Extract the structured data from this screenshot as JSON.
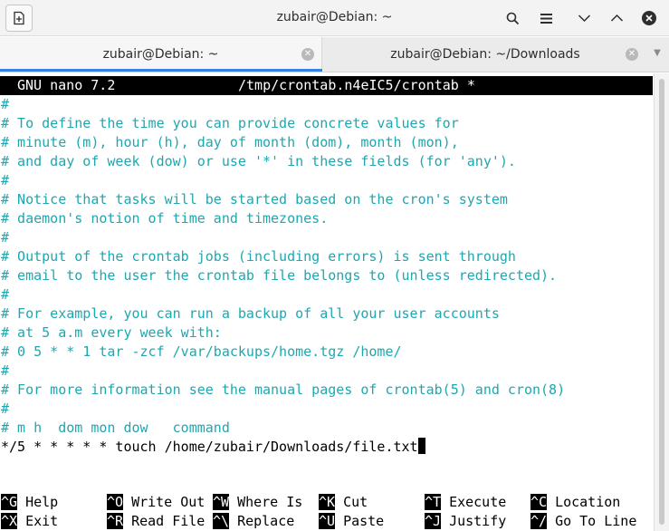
{
  "window": {
    "title": "zubair@Debian: ~",
    "new_tab_icon": "new-tab-icon",
    "search_icon": "search-icon",
    "menu_icon": "hamburger-menu-icon",
    "minimize_icon": "chevron-down-icon",
    "maximize_icon": "chevron-up-icon",
    "close_icon": "close-icon"
  },
  "tabs": [
    {
      "label": "zubair@Debian: ~",
      "active": true
    },
    {
      "label": "zubair@Debian: ~/Downloads",
      "active": false
    }
  ],
  "nano": {
    "program": "GNU nano 7.2",
    "filename": "/tmp/crontab.n4eIC5/crontab *",
    "lines": [
      "#",
      "# To define the time you can provide concrete values for",
      "# minute (m), hour (h), day of month (dom), month (mon),",
      "# and day of week (dow) or use '*' in these fields (for 'any').",
      "#",
      "# Notice that tasks will be started based on the cron's system",
      "# daemon's notion of time and timezones.",
      "#",
      "# Output of the crontab jobs (including errors) is sent through",
      "# email to the user the crontab file belongs to (unless redirected).",
      "#",
      "# For example, you can run a backup of all your user accounts",
      "# at 5 a.m every week with:",
      "# 0 5 * * 1 tar -zcf /var/backups/home.tgz /home/",
      "#",
      "# For more information see the manual pages of crontab(5) and cron(8)",
      "#",
      "# m h  dom mon dow   command",
      "*/5 * * * * * touch /home/zubair/Downloads/file.txt"
    ],
    "shortcuts_row1": [
      {
        "key": "^G",
        "label": "Help"
      },
      {
        "key": "^O",
        "label": "Write Out"
      },
      {
        "key": "^W",
        "label": "Where Is"
      },
      {
        "key": "^K",
        "label": "Cut"
      },
      {
        "key": "^T",
        "label": "Execute"
      },
      {
        "key": "^C",
        "label": "Location"
      }
    ],
    "shortcuts_row2": [
      {
        "key": "^X",
        "label": "Exit"
      },
      {
        "key": "^R",
        "label": "Read File"
      },
      {
        "key": "^\\",
        "label": "Replace"
      },
      {
        "key": "^U",
        "label": "Paste"
      },
      {
        "key": "^J",
        "label": "Justify"
      },
      {
        "key": "^/",
        "label": "Go To Line"
      }
    ]
  },
  "colors": {
    "comment": "#1fa7b0",
    "titlebar_bg": "#000000",
    "tab_accent": "#3584e4"
  }
}
